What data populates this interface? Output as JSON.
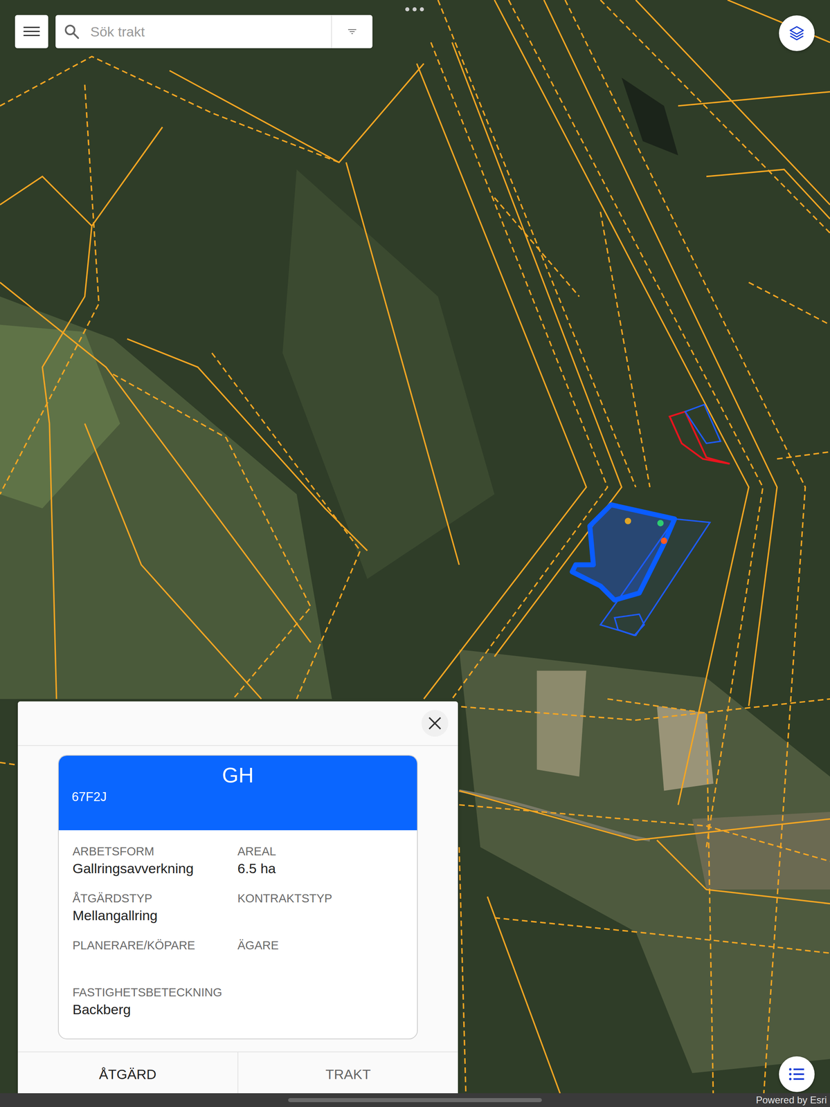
{
  "search": {
    "placeholder": "Sök trakt"
  },
  "map": {
    "markers": [
      {
        "color": "#e0a526"
      },
      {
        "color": "#2ecc71"
      },
      {
        "color": "#ff5a1f"
      }
    ],
    "attribution": "Powered by Esri"
  },
  "popup": {
    "title": "GH",
    "code": "67F2J",
    "fields": [
      {
        "label": "ARBETSFORM",
        "value": "Gallringsavverkning"
      },
      {
        "label": "AREAL",
        "value": "6.5 ha"
      },
      {
        "label": "ÅTGÄRDSTYP",
        "value": "Mellangallring"
      },
      {
        "label": "KONTRAKTSTYP",
        "value": ""
      },
      {
        "label": "PLANERARE/KÖPARE",
        "value": ""
      },
      {
        "label": "ÄGARE",
        "value": ""
      },
      {
        "label": "FASTIGHETSBETECKNING",
        "value": "Backberg"
      }
    ],
    "buttons": [
      "ÅTGÄRD",
      "TRAKT"
    ]
  }
}
